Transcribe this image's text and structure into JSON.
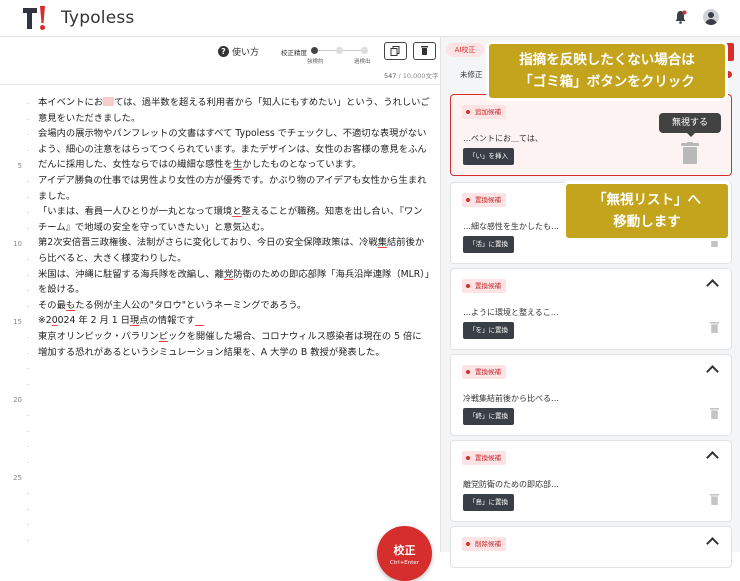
{
  "header": {
    "app_name": "Typoless",
    "logo_mark": "T!"
  },
  "toolbar": {
    "help_label": "使い方",
    "accuracy_label": "校正精度",
    "accuracy_low": "強検約",
    "accuracy_high": "過検出",
    "char_count": "547",
    "char_max": " / 10,000文字"
  },
  "editor": {
    "lines": [
      {
        "no": "",
        "segs": [
          [
            "t",
            "本イベントにお"
          ],
          [
            "box",
            ""
          ],
          [
            "t",
            "ては、過半数を超える利用者から「知人にもすめたい」という、うれしいご意見をいただきました。"
          ]
        ]
      },
      {
        "no": "",
        "segs": [
          [
            "t",
            "会場内の展示物やパンフレットの文書はすべて Typoless でチェックし、不適切な表現がないよう、細心の注意をはらってつくられています。またデザインは、女性のお客様の意見をふんだんに採用した、女性ならではの繊細な感性を"
          ],
          [
            "e",
            "生"
          ],
          [
            "t",
            "かしたものとなっています。"
          ]
        ]
      },
      {
        "no": "",
        "segs": [
          [
            "t",
            "アイデア勝負の仕事では男性より女性の方が優秀です。かぶり物のアイデアも女性から生まれました。"
          ]
        ]
      },
      {
        "no": "",
        "segs": [
          [
            "t",
            "「いまは、看員一人ひとりが一丸となって環境"
          ],
          [
            "e",
            "と"
          ],
          [
            "t",
            "整えることが職務。知恵を出し合い、『ワンチーム』で地域の安全を守っていきたい」と意気込む。"
          ]
        ]
      },
      {
        "no": "",
        "segs": [
          [
            "t",
            "第2次安倍晋三政権後、法制がさらに変化しており、今日の安全保障政策は、冷戦"
          ],
          [
            "e",
            "集"
          ],
          [
            "t",
            "結前後から比べると、大きく様変わりした。"
          ]
        ]
      },
      {
        "no": "",
        "segs": [
          [
            "t",
            "米国は、沖縄に駐留する海兵隊を改編し、離"
          ],
          [
            "e",
            "党"
          ],
          [
            "t",
            "防衛のための即応部隊「海兵沿岸連隊（MLR）」を設ける。"
          ]
        ]
      },
      {
        "no": "",
        "segs": [
          [
            "t",
            "その最"
          ],
          [
            "e",
            "も"
          ],
          [
            "t",
            "たる例が主人公の\"タロウ\"というネーミングであろう。"
          ]
        ]
      },
      {
        "no": "",
        "segs": [
          [
            "t",
            "※2"
          ],
          [
            "e",
            "0"
          ],
          [
            "t",
            "024 年 2 月 1 日"
          ],
          [
            "e",
            "現"
          ],
          [
            "t",
            "点の情報です"
          ],
          [
            "e",
            "　"
          ]
        ]
      },
      {
        "no": "",
        "segs": [
          [
            "t",
            "東京オリンピック・パラリン"
          ],
          [
            "e",
            "ピ"
          ],
          [
            "t",
            "ックを開催した場合、コロナウィルス感染者は現在の 5 倍に増加する恐れがあるというシミュレーション結果を、A 大学の B 教授が発表した。"
          ]
        ]
      }
    ],
    "line_numbers": [
      "5",
      "10",
      "15",
      "20",
      "25"
    ],
    "fab_label": "校正",
    "fab_shortcut": "Ctrl+Enter"
  },
  "sidebar": {
    "ai_badge": "AI校正",
    "tab_unfixed": "未修正",
    "cards": [
      {
        "tag": "追加候補",
        "snippet": "…ベントにお＿ては、",
        "action": "「い」を挿入",
        "active": true
      },
      {
        "tag": "置換候補",
        "snippet": "…細な感性を生かしたも…",
        "action": "「活」に置換",
        "active": false
      },
      {
        "tag": "置換候補",
        "snippet": "…ように環境と整えるこ…",
        "action": "「を」に置換",
        "active": false
      },
      {
        "tag": "置換候補",
        "snippet": "冷戦集結前後から比べる…",
        "action": "「終」に置換",
        "active": false
      },
      {
        "tag": "置換候補",
        "snippet": "離党防衛のための即応部…",
        "action": "「島」に置換",
        "active": false
      },
      {
        "tag": "削除候補",
        "snippet": "",
        "action": "",
        "active": false
      }
    ]
  },
  "annotations": {
    "callout_trash": [
      "指摘を反映したくない場合は",
      "「ゴミ箱」ボタンをクリック"
    ],
    "callout_ignore": [
      "「無視リスト」へ",
      "移動します"
    ],
    "tooltip": "無視する"
  },
  "colors": {
    "accent": "#d62d2d",
    "callout": "#c3a41c",
    "dark_button": "#3a3f47"
  }
}
